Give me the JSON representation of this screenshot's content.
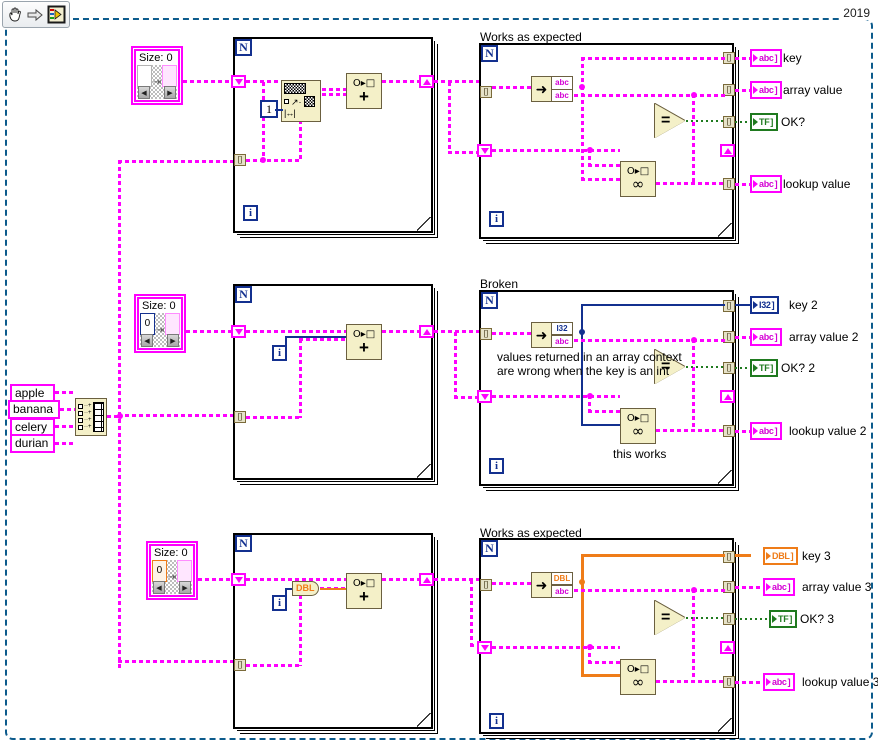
{
  "window": {
    "version_label": "2019"
  },
  "toolbar": {
    "items": [
      {
        "name": "hand-tool-icon",
        "label": "Hand Tool"
      },
      {
        "name": "arrow-tool-icon",
        "label": "Operate Tool"
      },
      {
        "name": "vi-front-panel-icon",
        "label": "Show Front Panel"
      }
    ]
  },
  "inputs": {
    "strings": [
      {
        "value": "apple"
      },
      {
        "value": "banana"
      },
      {
        "value": "celery"
      },
      {
        "value": "durian"
      }
    ],
    "build_array_label": "Build Array"
  },
  "sections": [
    {
      "id": "section-1",
      "title": "Works as expected",
      "map_constant": {
        "size_text": "Size: 0",
        "key_type": "String",
        "value_type": "String"
      },
      "loop_count_label": "N",
      "iteration_label": "i",
      "index_constant": "1",
      "add_node_label": "Add",
      "map_insert_label": "Map Insert",
      "map_lookup_label": "Look In Map",
      "equals_label": "=",
      "key_type_glyph": "abc",
      "value_type_glyph": "abc",
      "indicators": [
        {
          "name": "key",
          "label": "key",
          "type": "str",
          "glyph": "abc"
        },
        {
          "name": "array-value",
          "label": "array value",
          "type": "str",
          "glyph": "abc"
        },
        {
          "name": "ok",
          "label": "OK?",
          "type": "bool",
          "glyph": "TF"
        },
        {
          "name": "lookup-value",
          "label": "lookup value",
          "type": "str",
          "glyph": "abc"
        }
      ]
    },
    {
      "id": "section-2",
      "title": "Broken",
      "map_constant": {
        "size_text": "Size: 0",
        "key_type": "I32",
        "value_type": "String"
      },
      "loop_count_label": "N",
      "iteration_label": "i",
      "add_node_label": "Add",
      "map_lookup_label": "Look In Map",
      "equals_label": "=",
      "key_type_glyph": "I32",
      "value_type_glyph": "abc",
      "comment_main": "values returned in an array context\nare wrong when the key is an int",
      "comment_sub": "this works",
      "indicators": [
        {
          "name": "key-2",
          "label": "key 2",
          "type": "i32",
          "glyph": "I32"
        },
        {
          "name": "array-value-2",
          "label": "array value 2",
          "type": "str",
          "glyph": "abc"
        },
        {
          "name": "ok-2",
          "label": "OK? 2",
          "type": "bool",
          "glyph": "TF"
        },
        {
          "name": "lookup-value-2",
          "label": "lookup value 2",
          "type": "str",
          "glyph": "abc"
        }
      ]
    },
    {
      "id": "section-3",
      "title": "Works as expected",
      "map_constant": {
        "size_text": "Size: 0",
        "key_type": "DBL",
        "value_type": "String"
      },
      "loop_count_label": "N",
      "iteration_label": "i",
      "coercion_label": "DBL",
      "add_node_label": "Add",
      "map_lookup_label": "Look In Map",
      "equals_label": "=",
      "key_type_glyph": "DBL",
      "value_type_glyph": "abc",
      "indicators": [
        {
          "name": "key-3",
          "label": "key 3",
          "type": "dbl",
          "glyph": "DBL"
        },
        {
          "name": "array-value-3",
          "label": "array value 3",
          "type": "str",
          "glyph": "abc"
        },
        {
          "name": "ok-3",
          "label": "OK? 3",
          "type": "bool",
          "glyph": "TF"
        },
        {
          "name": "lookup-value-3",
          "label": "lookup value 3",
          "type": "str",
          "glyph": "abc"
        }
      ]
    }
  ],
  "colors": {
    "string_wire": "#ff00ff",
    "int_wire": "#13308f",
    "dbl_wire": "#ef7c18",
    "bool_wire": "#1f7a1f",
    "node_fill": "#f4f0c8",
    "frame": "#0d5b8c"
  }
}
